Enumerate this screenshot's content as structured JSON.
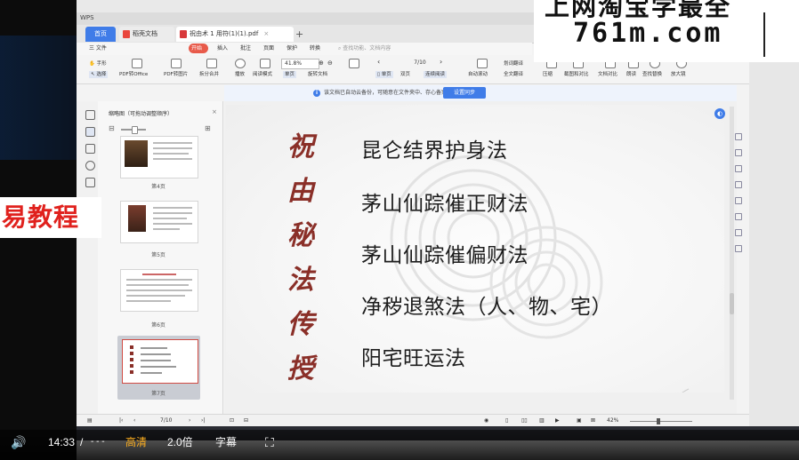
{
  "app": {
    "title_fragment": "WPS",
    "tabs": [
      {
        "label": "首页"
      },
      {
        "label": "稻壳文档"
      },
      {
        "label": "祝由术 1 用符(1)(1).pdf"
      }
    ],
    "add_tab": "+",
    "menus": [
      "三 文件",
      "开始",
      "插入",
      "批注",
      "页面",
      "保护",
      "转换"
    ],
    "menu_active": "开始",
    "search_placeholder": "查找功能、文档内容"
  },
  "ribbon": {
    "tools": [
      "手形",
      "选择",
      "PDF转Office",
      "PDF转图片",
      "拆分合并",
      "播放",
      "阅读模式",
      "旋转文档",
      "单页",
      "双页",
      "连续阅读",
      "自动滚动",
      "划词翻译",
      "全文翻译",
      "压缩",
      "截图和对比",
      "文档对比",
      "朗读",
      "查找替换",
      "放大镜"
    ],
    "zoom_value": "41.8%",
    "page_indicator": "7/10"
  },
  "notice": {
    "icon": "i",
    "text": "该文档已自动云备份，可随意在文件夹中、存心备案",
    "button": "设置同步"
  },
  "thumbnails": {
    "title": "缩略图（可拖动调整顺序）",
    "pages": [
      {
        "label": "第4页"
      },
      {
        "label": "第5页"
      },
      {
        "label": "第6页"
      },
      {
        "label": "第7页"
      }
    ]
  },
  "slide": {
    "vertical_title": [
      "祝",
      "由",
      "秘",
      "法",
      "传",
      "授"
    ],
    "lines": [
      "昆仑结界护身法",
      "茅山仙踪催正财法",
      "茅山仙踪催偏财法",
      "净秽退煞法（人、物、宅）",
      "阳宅旺运法"
    ]
  },
  "statusbar": {
    "page": "7/10",
    "zoom": "42%"
  },
  "watermarks": {
    "left": "易教程",
    "right_top": "上网淘宝学最全",
    "right_site": "761m.com"
  },
  "player": {
    "time": "14:33",
    "separator": "/",
    "duration": "- - -",
    "quality": "高清",
    "speed": "2.0倍",
    "subtitle": "字幕"
  },
  "colors": {
    "accent": "#3f7ce8",
    "calligraphy": "#8a2f28",
    "start_menu": "#e85a4a",
    "quality": "#ffb020"
  }
}
